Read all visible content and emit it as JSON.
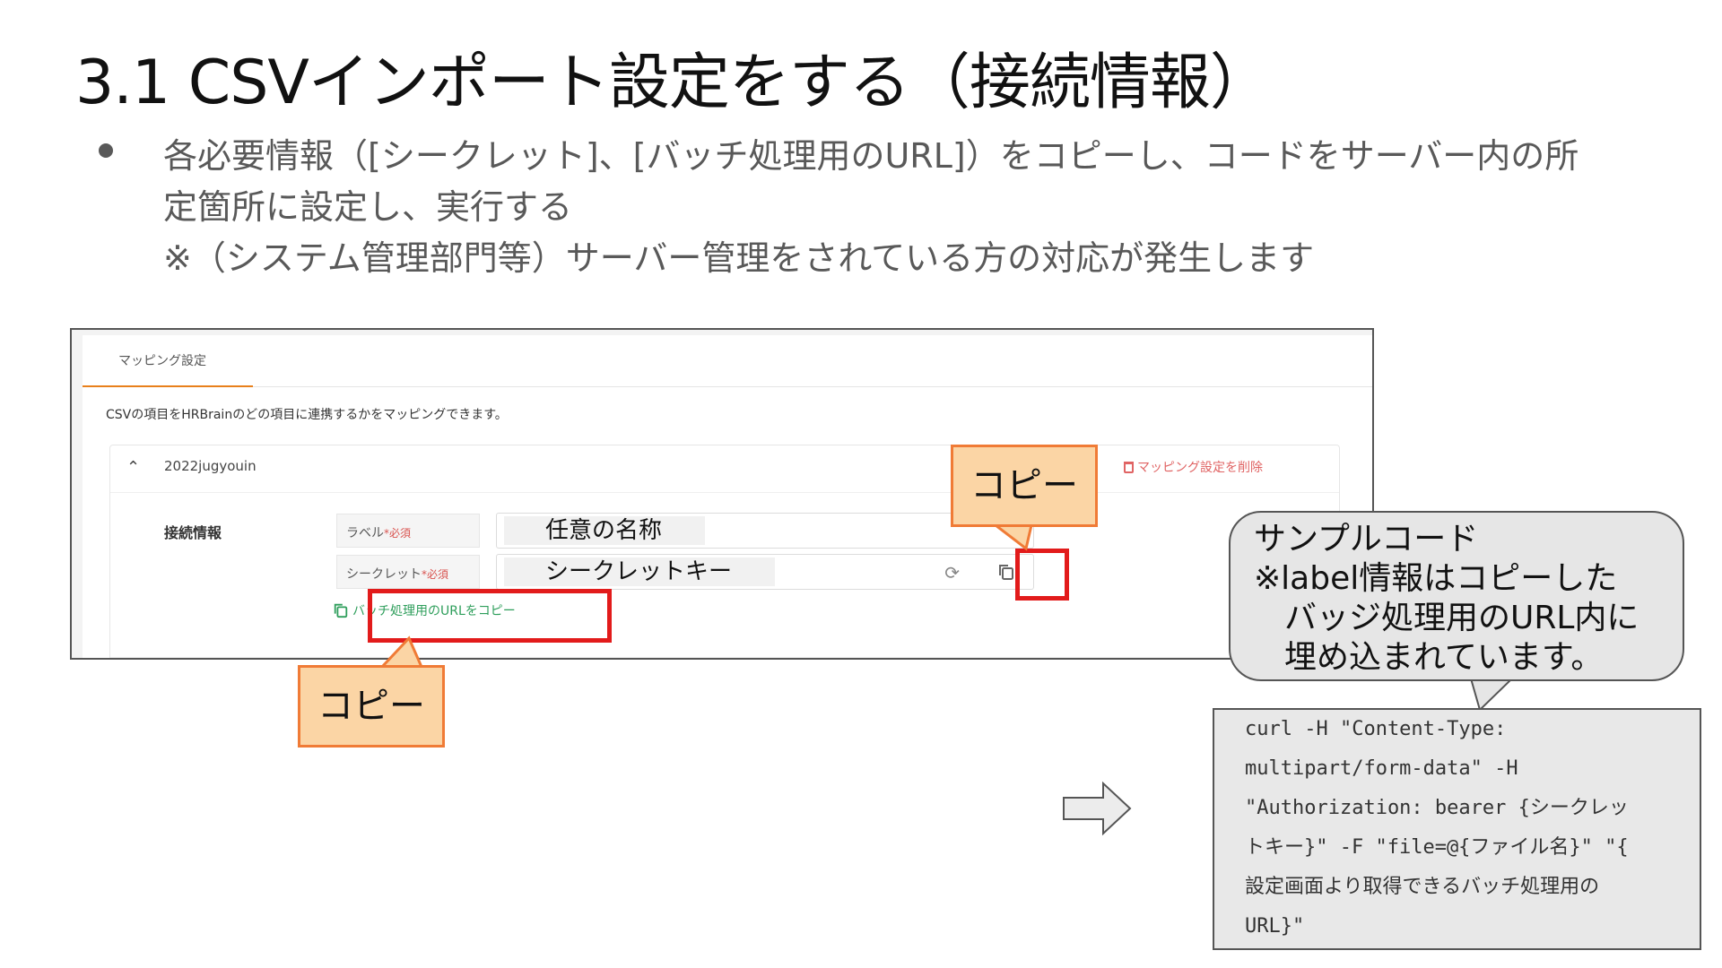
{
  "slide": {
    "title": "3.1 CSVインポート設定をする（接続情報）",
    "bullet": {
      "line1": "各必要情報（[シークレット]、[バッチ処理用のURL]）をコピーし、コードをサーバー内の所",
      "line2": "定箇所に設定し、実行する",
      "note": "※（システム管理部門等）サーバー管理をされている方の対応が発生します"
    }
  },
  "screenshot": {
    "tab_label": "マッピング設定",
    "description": "CSVの項目をHRBrainのどの項目に連携するかをマッピングできます。",
    "mapping_name": "2022jugyouin",
    "delete_label": "マッピング設定を削除",
    "section_label": "接続情報",
    "label_field": {
      "label": "ラベル",
      "required": "*必須",
      "value": "任意の名称"
    },
    "secret_field": {
      "label": "シークレット",
      "required": "*必須",
      "value": "シークレットキー"
    },
    "copy_url_label": "バッチ処理用のURLをコピー"
  },
  "callouts": {
    "top_copy": "コピー",
    "bottom_copy": "コピー"
  },
  "speech_bubble": {
    "line1": "サンプルコード",
    "line2": "※label情報はコピーした",
    "line3": "バッジ処理用のURL内に",
    "line4": "埋め込まれています。"
  },
  "code_sample": {
    "line1": "curl -H \"Content-Type:",
    "line2": "multipart/form-data\" -H",
    "line3": "\"Authorization: bearer {シークレッ",
    "line4": "トキー}\" -F \"file=@{ファイル名}\" \"{",
    "line5": "設定画面より取得できるバッチ処理用の",
    "line6": "URL}\""
  },
  "colors": {
    "accent_orange": "#e8801b",
    "highlight_red": "#e21b1b",
    "callout_fill": "#fbd5a5",
    "callout_border": "#f07b36",
    "link_green": "#2e9e5b",
    "delete_red": "#e06464"
  },
  "icons": [
    "chevron-up-icon",
    "trash-icon",
    "refresh-icon",
    "copy-icon",
    "right-arrow-icon"
  ]
}
